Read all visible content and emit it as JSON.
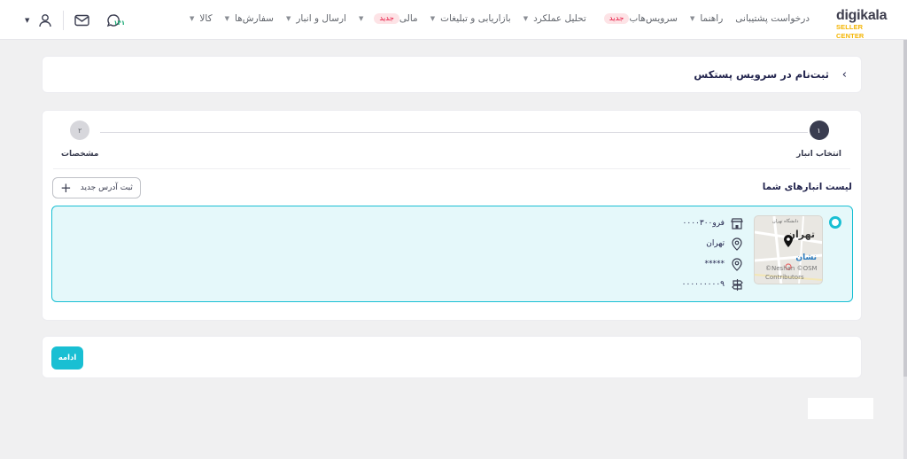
{
  "brand": {
    "name": "digikala",
    "sub": "SELLER CENTER"
  },
  "nav": [
    {
      "label": "کالا",
      "caret": true
    },
    {
      "label": "سفارش‌ها",
      "caret": true
    },
    {
      "label": "ارسال و انبار",
      "caret": true
    },
    {
      "label": "مالی",
      "caret": true,
      "badge": "جدید"
    },
    {
      "label": "بازاریابی و تبلیغات",
      "caret": true
    },
    {
      "label": "تحلیل عملکرد",
      "caret": true
    },
    {
      "label": "سرویس‌هاب",
      "caret": false,
      "badge": "جدید"
    },
    {
      "label": "راهنما",
      "caret": true
    },
    {
      "label": "درخواست پشتیبانی",
      "caret": false
    }
  ],
  "header_icons": {
    "support_count": "۱۴۱"
  },
  "page": {
    "title": "ثبت‌نام در سرویس پستکس"
  },
  "steps": [
    {
      "number": "۱",
      "label": "انتخاب انبار",
      "active": true
    },
    {
      "number": "۲",
      "label": "مشخصات",
      "active": false
    }
  ],
  "warehouses": {
    "title": "لیست انبارهای شما",
    "add_button": "ثبت آدرس جدید",
    "item": {
      "name": "فرو۰۰۰۰۳۰۰",
      "city": "تهران",
      "postal": "*****",
      "code": "۰۰۰۰۰۰۰۰۰۹",
      "map": {
        "city_label": "تهران",
        "small_label": "دانشگاه تهران",
        "brand": "نشان",
        "credit": "©Neshan ©OSM Contributors"
      }
    }
  },
  "footer": {
    "continue": "ادامه"
  },
  "colors": {
    "accent": "#19bfd3",
    "badge_bg": "#fde3e6",
    "badge_text": "#e6123d",
    "logo_yellow": "#f4b400"
  }
}
